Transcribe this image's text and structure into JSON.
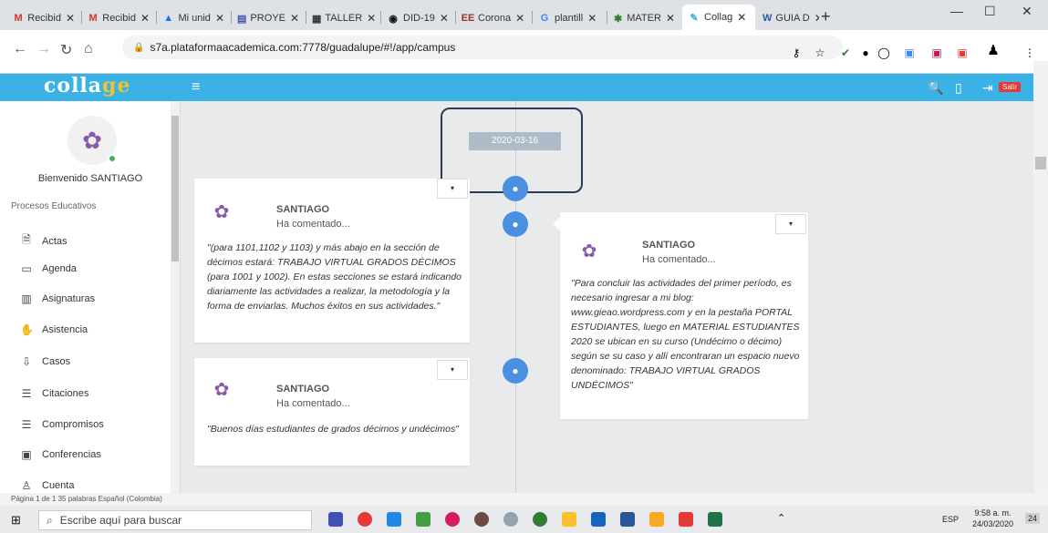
{
  "browser": {
    "tabs": [
      {
        "icon": "M",
        "icon_color": "#d93025",
        "label": "Recibid"
      },
      {
        "icon": "M",
        "icon_color": "#d93025",
        "label": "Recibid"
      },
      {
        "icon": "▲",
        "icon_color": "#1a73e8",
        "label": "Mi unid"
      },
      {
        "icon": "▤",
        "icon_color": "#3f51b5",
        "label": "PROYE"
      },
      {
        "icon": "▦",
        "icon_color": "#333",
        "label": "TALLER"
      },
      {
        "icon": "◉",
        "icon_color": "#111",
        "label": "DID-19"
      },
      {
        "icon": "EE",
        "icon_color": "#a03030",
        "label": "Corona"
      },
      {
        "icon": "G",
        "icon_color": "#4285f4",
        "label": "plantill"
      },
      {
        "icon": "✱",
        "icon_color": "#2e7d32",
        "label": "MATER"
      },
      {
        "icon": "✎",
        "icon_color": "#3ab2e5",
        "label": "Collag"
      },
      {
        "icon": "W",
        "icon_color": "#2b579a",
        "label": "GUIA D"
      }
    ],
    "close_glyph": "✕",
    "new_tab": "+",
    "url": "s7a.plataformaacademica.com:7778/guadalupe/#!/app/campus"
  },
  "app": {
    "logo_text": "colla",
    "logo_accent": "ge",
    "salir_label": "Salir",
    "accent_color": "#3ab2e5"
  },
  "sidebar": {
    "welcome": "Bienvenido SANTIAGO",
    "section_title": "Procesos Educativos",
    "items": [
      {
        "icon": "🗎",
        "label": "Actas"
      },
      {
        "icon": "▭",
        "label": "Agenda"
      },
      {
        "icon": "▥",
        "label": "Asignaturas"
      },
      {
        "icon": "✋",
        "label": "Asistencia"
      },
      {
        "icon": "⇩",
        "label": "Casos"
      },
      {
        "icon": "☰",
        "label": "Citaciones"
      },
      {
        "icon": "☰",
        "label": "Compromisos"
      },
      {
        "icon": "▣",
        "label": "Conferencias"
      },
      {
        "icon": "♙",
        "label": "Cuenta"
      }
    ]
  },
  "timeline": {
    "date": "2020-03-16",
    "posts": [
      {
        "author": "SANTIAGO",
        "action": "Ha comentado...",
        "text": "\"(para 1101,1102 y 1103) y más abajo en la sección de décimos estará: TRABAJO VIRTUAL GRADOS DÉCIMOS (para 1001 y 1002). En estas secciones se estará indicando diariamente las actividades a realizar, la metodología y la forma de enviarlas. Muchos éxitos en sus actividades.\""
      },
      {
        "author": "SANTIAGO",
        "action": "Ha comentado...",
        "text": "\"Para concluir las actividades del primer período, es necesario ingresar a mi blog: www.gieao.wordpress.com y en la pestaña PORTAL ESTUDIANTES, luego en MATERIAL ESTUDIANTES 2020 se ubican en su curso (Undécimo o décimo) según se su caso y allí encontraran un espacio nuevo denominado: TRABAJO VIRTUAL GRADOS UNDÉCIMOS\""
      },
      {
        "author": "SANTIAGO",
        "action": "Ha comentado...",
        "text": "\"Buenos días estudiantes de grados décimos y undécimos\""
      }
    ]
  },
  "word_status": "Página 1 de 1    35 palabras    Español (Colombia)",
  "taskbar": {
    "search_placeholder": "Escribe aquí para buscar",
    "lang": "ESP",
    "time": "9:58 a. m.",
    "date": "24/03/2020",
    "notif_count": "24"
  }
}
